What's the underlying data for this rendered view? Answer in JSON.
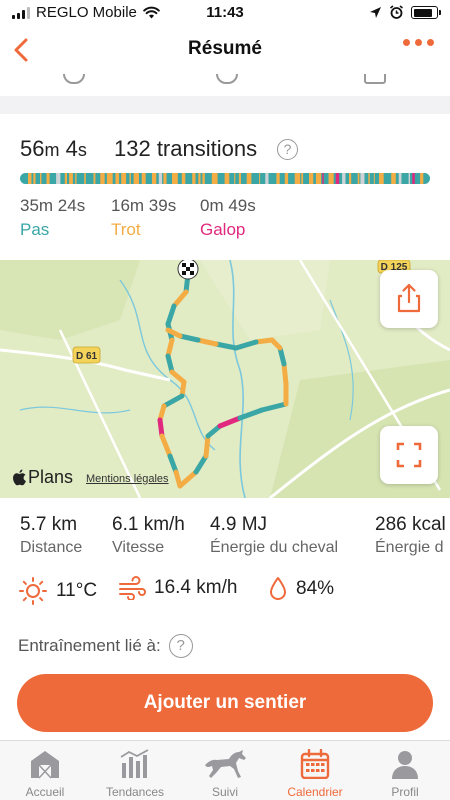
{
  "status_bar": {
    "carrier": "REGLO Mobile",
    "time": "11:43"
  },
  "nav": {
    "title": "Résumé"
  },
  "summary": {
    "duration_minutes": "56",
    "duration_minutes_unit": "m",
    "duration_seconds": "4",
    "duration_seconds_unit": "s",
    "transitions": "132 transitions",
    "gaits": [
      {
        "time": "35m 24s",
        "name": "Pas",
        "color": "#3aa6a6"
      },
      {
        "time": "16m 39s",
        "name": "Trot",
        "color": "#f4ad45"
      },
      {
        "time": "0m 49s",
        "name": "Galop",
        "color": "#e0297e"
      }
    ]
  },
  "map": {
    "road_labels": [
      "D 61",
      "D 125"
    ],
    "provider": "Plans",
    "legal_link": "Mentions légales",
    "route_colors": {
      "walk": "#3aa6a6",
      "trot": "#f4ad45",
      "gallop": "#e0297e"
    }
  },
  "stats": [
    {
      "value": "5.7 km",
      "label": "Distance"
    },
    {
      "value": "6.1 km/h",
      "label": "Vitesse"
    },
    {
      "value": "4.9 MJ",
      "label": "Énergie du cheval"
    },
    {
      "value": "286 kcal",
      "label": "Énergie d"
    }
  ],
  "weather": {
    "temperature": "11°C",
    "wind": "16.4 km/h",
    "humidity": "84%"
  },
  "linked_training": {
    "label": "Entraînement lié à:"
  },
  "cta": {
    "label": "Ajouter un sentier"
  },
  "tabs": [
    {
      "label": "Accueil",
      "icon": "barn-icon",
      "active": false
    },
    {
      "label": "Tendances",
      "icon": "trends-icon",
      "active": false
    },
    {
      "label": "Suivi",
      "icon": "horse-icon",
      "active": false
    },
    {
      "label": "Calendrier",
      "icon": "calendar-icon",
      "active": true
    },
    {
      "label": "Profil",
      "icon": "profile-icon",
      "active": false
    }
  ],
  "colors": {
    "accent": "#ef6a3a",
    "walk": "#3aa6a6",
    "trot": "#f4ad45",
    "gallop": "#e0297e"
  }
}
